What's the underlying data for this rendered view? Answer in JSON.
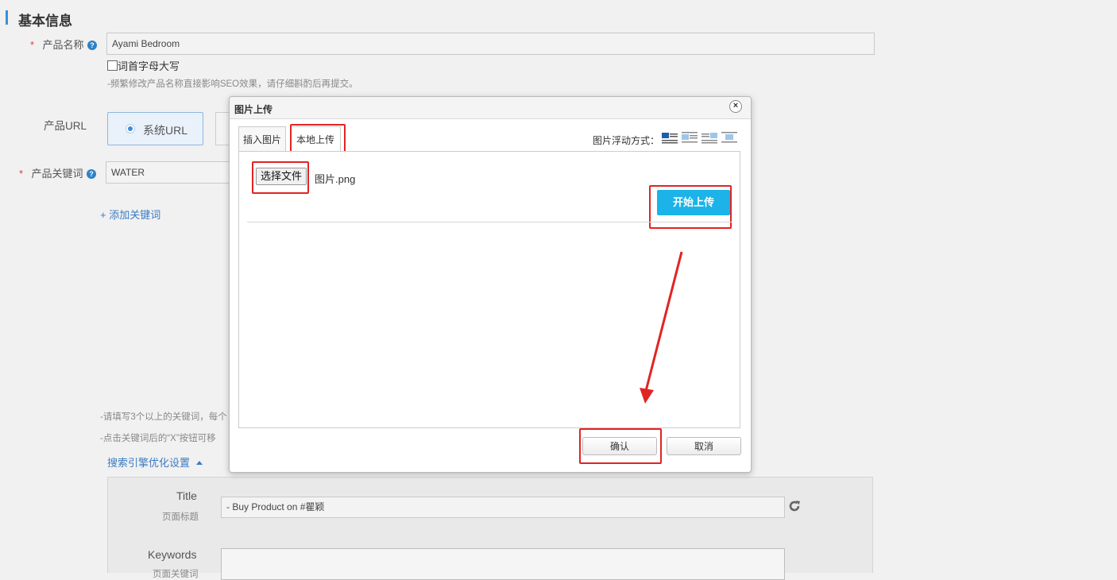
{
  "form": {
    "section_title": "基本信息",
    "required_mark": "*",
    "product_name_label": "产品名称",
    "product_name_value": "Ayami Bedroom",
    "capitalize_label": "词首字母大写",
    "name_hint": "-频繁修改产品名称直接影响SEO效果，请仔细斟酌后再提交。",
    "product_url_label": "产品URL",
    "url_option_system": "系统URL",
    "keywords_label": "产品关键词",
    "keywords_value": "WATER",
    "add_keyword_link": "+ 添加关键词",
    "keyword_hint_1": "-请填写3个以上的关键词，每个",
    "keyword_hint_2": "-点击关键词后的“X”按钮可移",
    "seo_toggle": "搜索引擎优化设置",
    "seo": {
      "title_label": "Title",
      "title_sub": "页面标题",
      "title_value": "- Buy Product on #瞿颖",
      "keywords_label": "Keywords",
      "keywords_sub": "页面关键词"
    }
  },
  "dialog": {
    "title": "图片上传",
    "tabs": [
      "插入图片",
      "本地上传"
    ],
    "active_tab": "本地上传",
    "float_label": "图片浮动方式：",
    "float_options": [
      "float-left",
      "float-none",
      "float-right",
      "float-center"
    ],
    "choose_file_label": "选择文件",
    "file_name": "图片.png",
    "start_upload_label": "开始上传",
    "confirm_label": "确认",
    "cancel_label": "取消"
  },
  "colors": {
    "highlight": "#e12424",
    "upload_button": "#1bb3e8",
    "link": "#3b7cc2"
  }
}
